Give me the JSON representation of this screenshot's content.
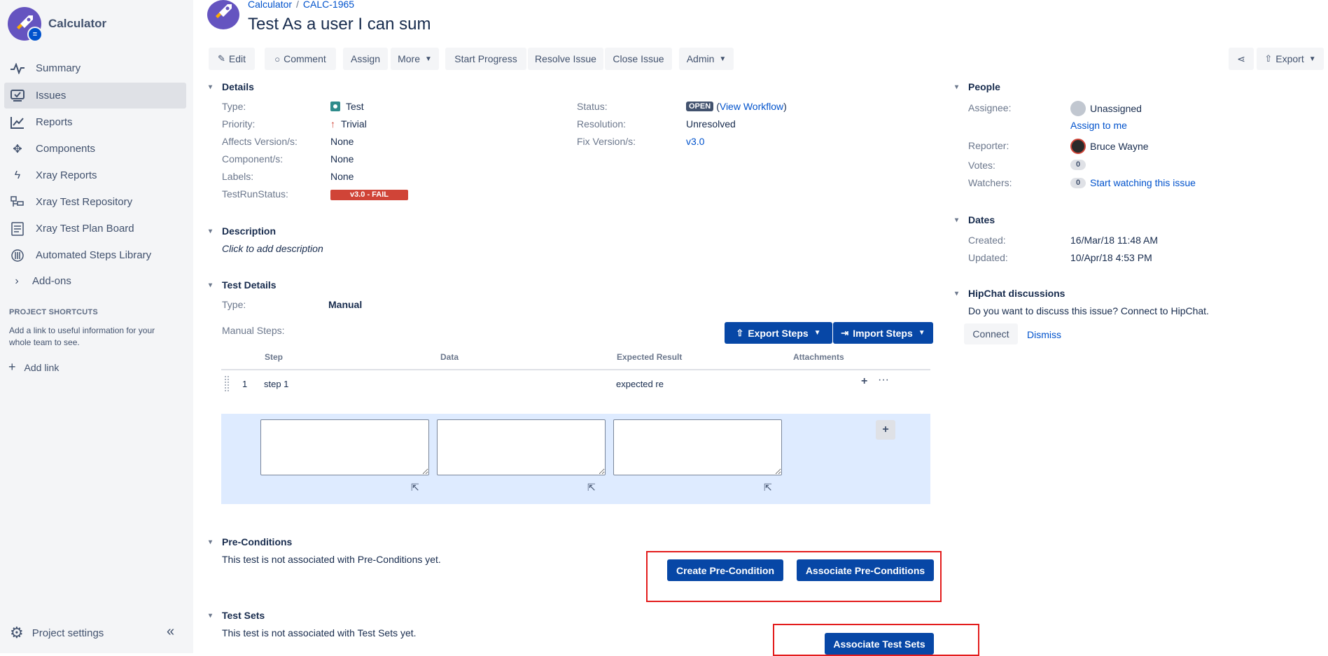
{
  "sidebar": {
    "project_name": "Calculator",
    "items": [
      {
        "label": "Summary",
        "icon": "pulse-icon"
      },
      {
        "label": "Issues",
        "icon": "issues-icon"
      },
      {
        "label": "Reports",
        "icon": "chart-icon"
      },
      {
        "label": "Components",
        "icon": "puzzle-icon"
      },
      {
        "label": "Xray Reports",
        "icon": "lightning-icon"
      },
      {
        "label": "Xray Test Repository",
        "icon": "repository-icon"
      },
      {
        "label": "Xray Test Plan Board",
        "icon": "board-icon"
      },
      {
        "label": "Automated Steps Library",
        "icon": "library-icon"
      }
    ],
    "addons_label": "Add-ons",
    "shortcuts_heading": "PROJECT SHORTCUTS",
    "shortcuts_text": "Add a link to useful information for your whole team to see.",
    "add_link": "Add link",
    "project_settings": "Project settings"
  },
  "header": {
    "breadcrumb_project": "Calculator",
    "breadcrumb_separator": "/",
    "breadcrumb_issue": "CALC-1965",
    "title": "Test As a user I can sum"
  },
  "toolbar": {
    "edit": "Edit",
    "comment": "Comment",
    "assign": "Assign",
    "more": "More",
    "start_progress": "Start Progress",
    "resolve_issue": "Resolve Issue",
    "close_issue": "Close Issue",
    "admin": "Admin",
    "export": "Export"
  },
  "details": {
    "heading": "Details",
    "type_label": "Type:",
    "type_value": "Test",
    "priority_label": "Priority:",
    "priority_value": "Trivial",
    "affects_label": "Affects Version/s:",
    "affects_value": "None",
    "component_label": "Component/s:",
    "component_value": "None",
    "labels_label": "Labels:",
    "labels_value": "None",
    "testrun_label": "TestRunStatus:",
    "testrun_value": "v3.0 - FAIL",
    "status_label": "Status:",
    "status_value": "OPEN",
    "workflow_open": "(",
    "workflow_link": "View Workflow",
    "workflow_close": ")",
    "resolution_label": "Resolution:",
    "resolution_value": "Unresolved",
    "fix_label": "Fix Version/s:",
    "fix_value": "v3.0"
  },
  "description": {
    "heading": "Description",
    "placeholder": "Click to add description"
  },
  "test_details": {
    "heading": "Test Details",
    "type_label": "Type:",
    "type_value": "Manual",
    "manual_steps_label": "Manual Steps:",
    "export_steps": "Export Steps",
    "import_steps": "Import Steps",
    "columns": [
      "Step",
      "Data",
      "Expected Result",
      "Attachments"
    ],
    "steps": [
      {
        "index": "1",
        "step": "step 1",
        "data": "",
        "expected": "expected re"
      }
    ]
  },
  "preconditions": {
    "heading": "Pre-Conditions",
    "text": "This test is not associated with Pre-Conditions yet.",
    "create_button": "Create Pre-Condition",
    "associate_button": "Associate Pre-Conditions"
  },
  "test_sets": {
    "heading": "Test Sets",
    "text": "This test is not associated with Test Sets yet.",
    "associate_button": "Associate Test Sets"
  },
  "people": {
    "heading": "People",
    "assignee_label": "Assignee:",
    "assignee_value": "Unassigned",
    "assign_to_me": "Assign to me",
    "reporter_label": "Reporter:",
    "reporter_value": "Bruce Wayne",
    "votes_label": "Votes:",
    "votes_value": "0",
    "watchers_label": "Watchers:",
    "watchers_value": "0",
    "start_watching": "Start watching this issue"
  },
  "dates": {
    "heading": "Dates",
    "created_label": "Created:",
    "created_value": "16/Mar/18 11:48 AM",
    "updated_label": "Updated:",
    "updated_value": "10/Apr/18 4:53 PM"
  },
  "hipchat": {
    "heading": "HipChat discussions",
    "text": "Do you want to discuss this issue? Connect to HipChat.",
    "connect": "Connect",
    "dismiss": "Dismiss"
  },
  "colors": {
    "primary_button": "#0747a6",
    "link": "#0052cc",
    "fail": "#d04437",
    "highlight_box": "#e31c1c",
    "new_step_row": "#deebff"
  }
}
